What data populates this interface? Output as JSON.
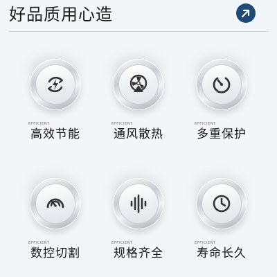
{
  "header": {
    "title": "好品质用心造",
    "arrow_icon": "arrow-up-right-icon",
    "accent_color": "#1f4a76"
  },
  "features": [
    {
      "badge": "EFFICIENT",
      "label": "高效节能",
      "icon": "energy-saving-icon"
    },
    {
      "badge": "EFFICIENT",
      "label": "通风散热",
      "icon": "fan-ventilation-icon"
    },
    {
      "badge": "EFFICIENT",
      "label": "多重保护",
      "icon": "protection-power-icon"
    },
    {
      "badge": "EFFICIENT",
      "label": "数控切割",
      "icon": "gauge-icon"
    },
    {
      "badge": "EFFICIENT",
      "label": "规格齐全",
      "icon": "audio-wave-icon"
    },
    {
      "badge": "EFFICIENT",
      "label": "寿命长久",
      "icon": "clock-icon"
    }
  ]
}
